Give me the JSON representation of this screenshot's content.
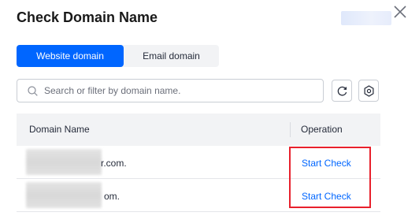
{
  "dialog": {
    "title": "Check Domain Name"
  },
  "tabs": [
    {
      "label": "Website domain",
      "active": true
    },
    {
      "label": "Email domain",
      "active": false
    }
  ],
  "search": {
    "placeholder": "Search or filter by domain name.",
    "value": ""
  },
  "toolbar": {
    "refresh_icon": "refresh-icon",
    "settings_icon": "gear-icon"
  },
  "table": {
    "columns": [
      "Domain Name",
      "Operation"
    ],
    "rows": [
      {
        "domain_visible_suffix": "r.com.",
        "action": "Start Check"
      },
      {
        "domain_visible_suffix": "om.",
        "action": "Start Check"
      }
    ]
  },
  "colors": {
    "accent": "#0066ff",
    "highlight": "#e8202c"
  }
}
